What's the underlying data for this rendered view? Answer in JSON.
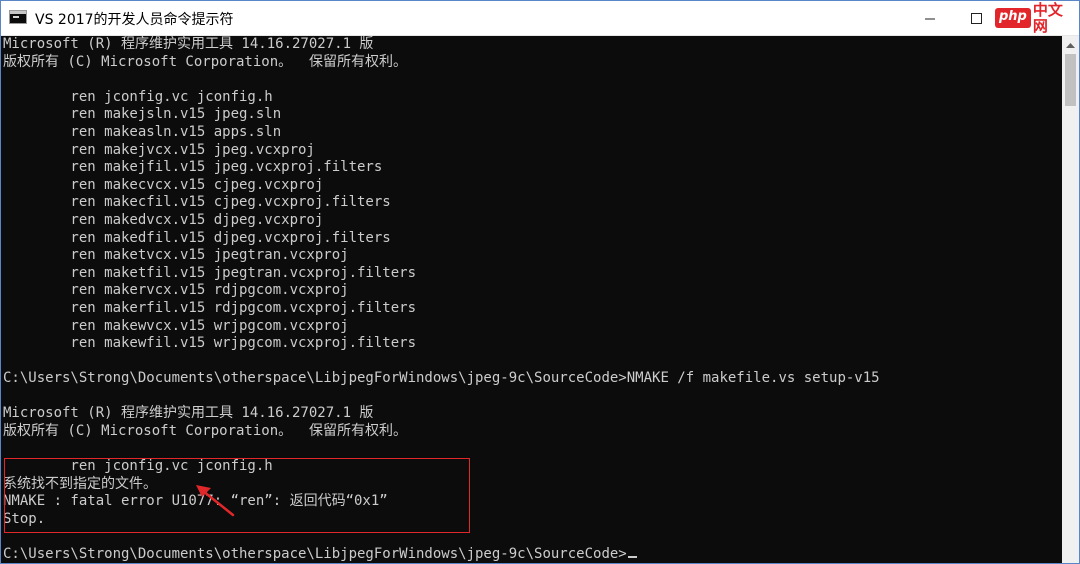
{
  "window": {
    "title": "VS 2017的开发人员命令提示符",
    "icon": "console-app-icon"
  },
  "controls": {
    "minimize_icon": "minimize-icon",
    "maximize_icon": "maximize-icon"
  },
  "watermark": {
    "badge": "php",
    "text": "中文网"
  },
  "console": {
    "lines": [
      "Microsoft (R) 程序维护实用工具 14.16.27027.1 版",
      "版权所有 (C) Microsoft Corporation。  保留所有权利。",
      "",
      "        ren jconfig.vc jconfig.h",
      "        ren makejsln.v15 jpeg.sln",
      "        ren makeasln.v15 apps.sln",
      "        ren makejvcx.v15 jpeg.vcxproj",
      "        ren makejfil.v15 jpeg.vcxproj.filters",
      "        ren makecvcx.v15 cjpeg.vcxproj",
      "        ren makecfil.v15 cjpeg.vcxproj.filters",
      "        ren makedvcx.v15 djpeg.vcxproj",
      "        ren makedfil.v15 djpeg.vcxproj.filters",
      "        ren maketvcx.v15 jpegtran.vcxproj",
      "        ren maketfil.v15 jpegtran.vcxproj.filters",
      "        ren makervcx.v15 rdjpgcom.vcxproj",
      "        ren makerfil.v15 rdjpgcom.vcxproj.filters",
      "        ren makewvcx.v15 wrjpgcom.vcxproj",
      "        ren makewfil.v15 wrjpgcom.vcxproj.filters",
      "",
      "C:\\Users\\Strong\\Documents\\otherspace\\LibjpegForWindows\\jpeg-9c\\SourceCode>NMAKE /f makefile.vs setup-v15",
      "",
      "Microsoft (R) 程序维护实用工具 14.16.27027.1 版",
      "版权所有 (C) Microsoft Corporation。  保留所有权利。",
      "",
      "        ren jconfig.vc jconfig.h",
      "系统找不到指定的文件。",
      "NMAKE : fatal error U1077: “ren”: 返回代码“0x1”",
      "Stop.",
      "",
      "C:\\Users\\Strong\\Documents\\otherspace\\LibjpegForWindows\\jpeg-9c\\SourceCode>"
    ]
  },
  "scrollbar": {
    "up_icon": "scroll-up-arrow-icon"
  },
  "annotation": {
    "box_color": "#e0282a",
    "arrow_icon": "red-arrow-icon"
  }
}
